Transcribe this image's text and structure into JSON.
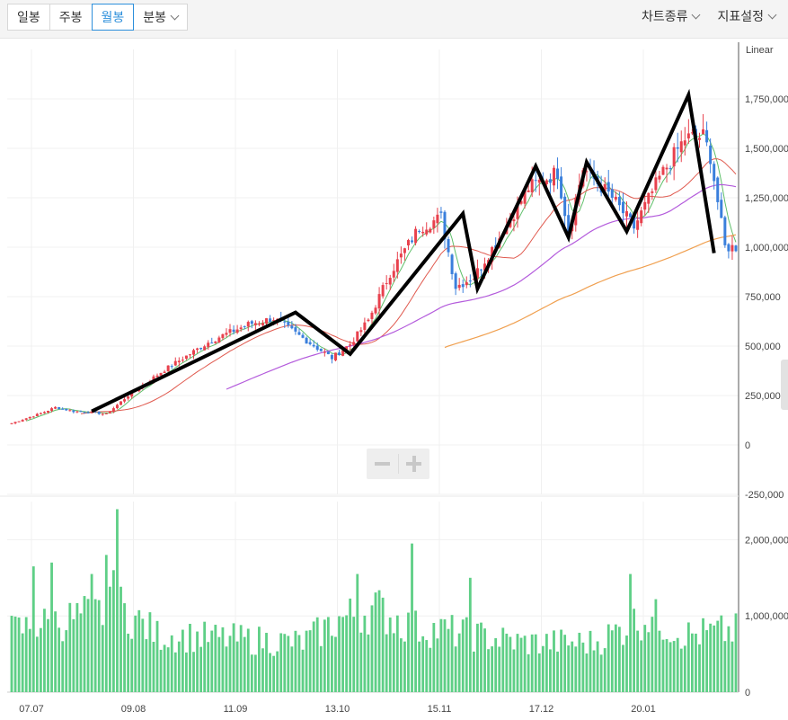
{
  "toolbar": {
    "tabs": [
      {
        "label": "일봉",
        "active": false
      },
      {
        "label": "주봉",
        "active": false
      },
      {
        "label": "월봉",
        "active": true
      },
      {
        "label": "분봉",
        "active": false
      }
    ],
    "chart_type_label": "차트종류",
    "indicator_label": "지표설정"
  },
  "chart_data": {
    "type": "candlestick",
    "scale_label": "Linear",
    "x_tick_labels": [
      "07.07",
      "09.08",
      "11.09",
      "13.10",
      "15.11",
      "17.12",
      "20.01"
    ],
    "price_axis": {
      "ylim": [
        -250000,
        2000000
      ],
      "ticks": [
        -250000,
        0,
        250000,
        500000,
        750000,
        1000000,
        1250000,
        1500000,
        1750000
      ],
      "tick_labels": [
        "-250,000",
        "0",
        "250,000",
        "500,000",
        "750,000",
        "1,000,000",
        "1,250,000",
        "1,500,000",
        "1,750,000"
      ]
    },
    "volume_axis": {
      "ylim": [
        0,
        2500000
      ],
      "ticks": [
        0,
        1000000,
        2000000
      ],
      "tick_labels": [
        "0",
        "1,000,000",
        "2,000,000"
      ]
    },
    "colors": {
      "up": "#e8414d",
      "down": "#3a7fdc",
      "volume": "#5ecf86",
      "ma_short": "#5fbf6a",
      "ma_mid": "#e05a4f",
      "ma_long": "#b45cdc",
      "ma_xlong": "#f0a050",
      "annotation": "#000000",
      "grid": "#f0f0f0"
    },
    "close_keypoints": [
      [
        0,
        110000
      ],
      [
        8,
        160000
      ],
      [
        12,
        190000
      ],
      [
        17,
        170000
      ],
      [
        22,
        165000
      ],
      [
        26,
        155000
      ],
      [
        32,
        250000
      ],
      [
        42,
        380000
      ],
      [
        55,
        530000
      ],
      [
        65,
        610000
      ],
      [
        72,
        640000
      ],
      [
        80,
        540000
      ],
      [
        88,
        440000
      ],
      [
        93,
        510000
      ],
      [
        98,
        630000
      ],
      [
        104,
        870000
      ],
      [
        112,
        1100000
      ],
      [
        118,
        1150000
      ],
      [
        122,
        800000
      ],
      [
        127,
        850000
      ],
      [
        134,
        1050000
      ],
      [
        142,
        1300000
      ],
      [
        150,
        1380000
      ],
      [
        153,
        1080000
      ],
      [
        157,
        1400000
      ],
      [
        165,
        1250000
      ],
      [
        171,
        1100000
      ],
      [
        178,
        1350000
      ],
      [
        185,
        1550000
      ],
      [
        190,
        1560000
      ],
      [
        192,
        1460000
      ],
      [
        196,
        1000000
      ],
      [
        199,
        1000000
      ]
    ],
    "annotation_zigzag": [
      [
        22,
        170000
      ],
      [
        78,
        670000
      ],
      [
        93,
        460000
      ],
      [
        124,
        1170000
      ],
      [
        128,
        790000
      ],
      [
        144,
        1410000
      ],
      [
        153,
        1050000
      ],
      [
        158,
        1430000
      ],
      [
        169,
        1080000
      ],
      [
        186,
        1770000
      ],
      [
        193,
        970000
      ]
    ],
    "volume_keypoints": [
      [
        0,
        800000
      ],
      [
        10,
        900000
      ],
      [
        20,
        1000000
      ],
      [
        30,
        1100000
      ],
      [
        40,
        750000
      ],
      [
        60,
        700000
      ],
      [
        80,
        650000
      ],
      [
        90,
        950000
      ],
      [
        100,
        1100000
      ],
      [
        110,
        850000
      ],
      [
        120,
        800000
      ],
      [
        140,
        650000
      ],
      [
        160,
        650000
      ],
      [
        175,
        1000000
      ],
      [
        185,
        750000
      ],
      [
        199,
        800000
      ]
    ],
    "volume_spikes": [
      [
        6,
        1650000
      ],
      [
        11,
        1700000
      ],
      [
        22,
        1550000
      ],
      [
        26,
        1800000
      ],
      [
        28,
        1600000
      ],
      [
        29,
        2400000
      ],
      [
        95,
        1550000
      ],
      [
        110,
        1950000
      ],
      [
        126,
        1500000
      ],
      [
        170,
        1550000
      ]
    ]
  }
}
